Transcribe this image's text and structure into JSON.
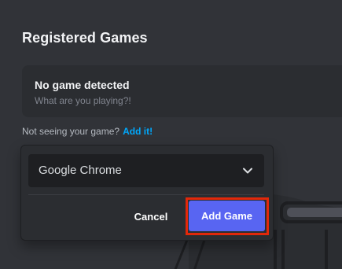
{
  "section": {
    "title": "Registered Games"
  },
  "detected": {
    "title": "No game detected",
    "subtitle": "What are you playing?!"
  },
  "prompt": {
    "text": "Not seeing your game?",
    "link": "Add it!"
  },
  "popup": {
    "selected_game": "Google Chrome",
    "cancel_label": "Cancel",
    "add_label": "Add Game"
  },
  "colors": {
    "background": "#313338",
    "card": "#2b2d31",
    "input": "#1e1f22",
    "accent": "#5865f2",
    "link": "#00a8fc",
    "highlight": "#e2280a"
  },
  "icons": {
    "dropdown": "chevron-down-icon"
  }
}
